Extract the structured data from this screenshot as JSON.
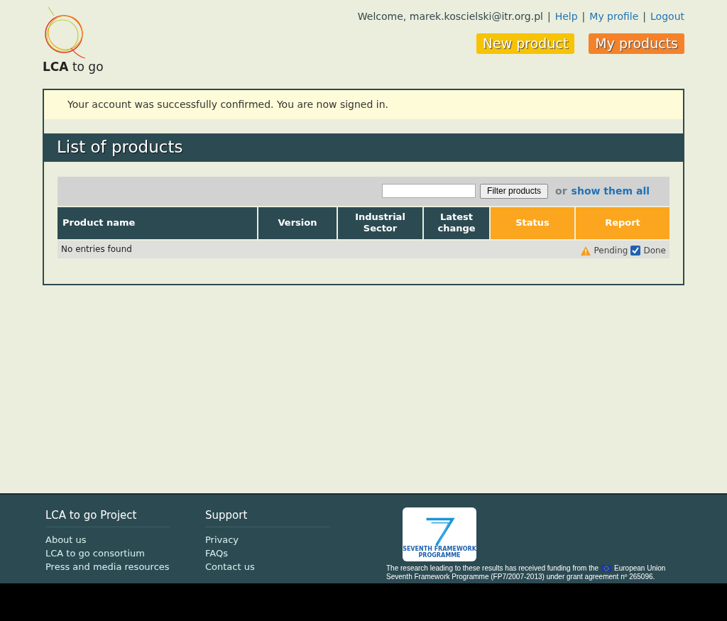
{
  "logo": {
    "text": "LCA",
    "suffix": "to go"
  },
  "user_nav": {
    "welcome": "Welcome, marek.koscielski@itr.org.pl",
    "links": [
      "Help",
      "My profile",
      "Logout"
    ],
    "separator": "|"
  },
  "action_buttons": [
    {
      "label": "New product",
      "color": "#f7c305"
    },
    {
      "label": "My products",
      "color": "#f5822a"
    }
  ],
  "flash": "Your account was successfully confirmed. You are now signed in.",
  "section_title": "List of products",
  "filter": {
    "button": "Filter products",
    "or": "or",
    "show_all": "show them all"
  },
  "table": {
    "columns": [
      {
        "label": "Product name",
        "color": "#2c4a52"
      },
      {
        "label": "Version",
        "color": "#2c4a52"
      },
      {
        "label": "Industrial Sector",
        "color": "#2c4a52"
      },
      {
        "label": "Latest change",
        "color": "#2c4a52"
      },
      {
        "label": "Status",
        "color": "#fba61e"
      },
      {
        "label": "Report",
        "color": "#fba61e"
      }
    ],
    "empty": "No entries found",
    "legend": [
      {
        "kind": "warning",
        "label": "Pending"
      },
      {
        "kind": "check",
        "label": "Done"
      }
    ]
  },
  "footer": {
    "columns": [
      {
        "title": "LCA to go Project",
        "links": [
          "About us",
          "LCA to go consortium",
          "Press and media resources"
        ]
      },
      {
        "title": "Support",
        "links": [
          "Privacy",
          "FAQs",
          "Contact us"
        ]
      }
    ],
    "fp7_logo": [
      "SEVENTH FRAMEWORK",
      "PROGRAMME"
    ],
    "funding_before": "The research leading to these results has received funding from the",
    "funding_after": "European Union",
    "funding_line2": "Seventh Framework Programme (FP7/2007-2013) under grant agreement nº 265096."
  }
}
